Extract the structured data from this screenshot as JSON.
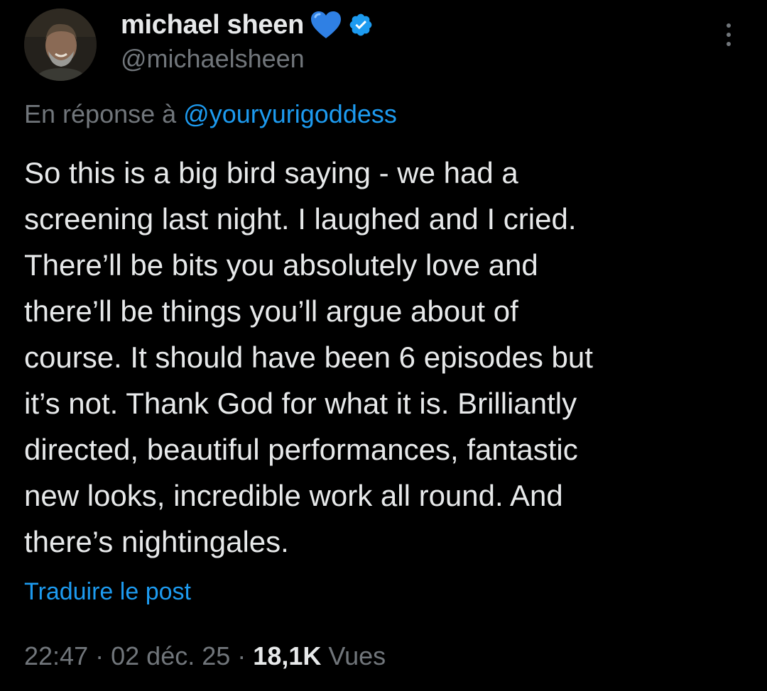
{
  "author": {
    "display_name": "michael sheen",
    "handle": "@michaelsheen",
    "emoji_icon": "blue-heart-icon",
    "verified_icon": "verified-badge-icon",
    "verified_color": "#1d9bf0"
  },
  "menu": {
    "icon": "more-vertical-icon"
  },
  "reply": {
    "prefix": "En réponse à",
    "handle": "@youryurigoddess"
  },
  "tweet": {
    "lines": [
      "So this is a big bird saying - we had a",
      "screening last night. I laughed and I cried.",
      "There’ll be bits you absolutely love and",
      "there’ll be things you’ll argue about of",
      "course. It should have been 6 episodes but",
      "it’s not. Thank God for what it is. Brilliantly",
      "directed, beautiful performances, fantastic",
      "new looks, incredible work all round. And",
      "there’s nightingales."
    ]
  },
  "translate_label": "Traduire le post",
  "meta": {
    "time": "22:47",
    "separator": "·",
    "date": "02 déc. 25",
    "views_count": "18,1K",
    "views_label": "Vues"
  },
  "colors": {
    "background": "#000000",
    "text_primary": "#e7e9ea",
    "text_secondary": "#71767b",
    "accent": "#1d9bf0"
  }
}
